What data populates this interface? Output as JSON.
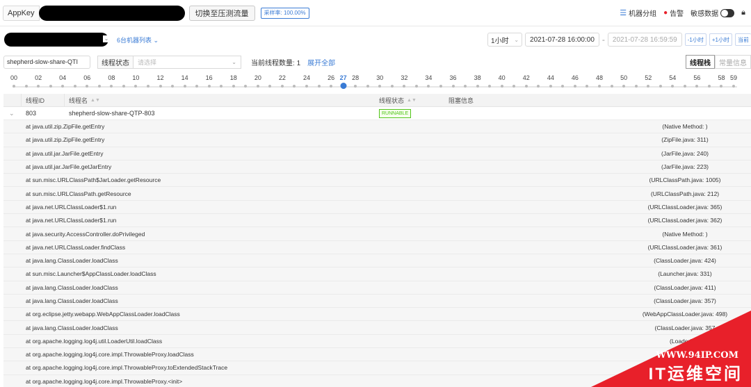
{
  "topbar": {
    "appkey_label": "AppKey",
    "switch_button": "切换至压测流量",
    "sample_rate": "采样率: 100.00%",
    "machine_group": "机器分组",
    "alert": "告警",
    "sensitive": "敏感数据"
  },
  "filter": {
    "machine_list": "6台机器列表",
    "range": "1小时",
    "start_time": "2021-07-28 16:00:00",
    "end_time": "2021-07-28 16:59:59",
    "minus_hour": "-1小时",
    "plus_hour": "+1小时",
    "current": "当前"
  },
  "search": {
    "thread_name": "shepherd-slow-share-QTI",
    "state_label": "线程状态",
    "state_placeholder": "请选择",
    "count_label": "当前线程数量",
    "count_value": "1",
    "expand_all": "展开全部",
    "view_stack": "线程栈",
    "view_constant": "常量信息"
  },
  "timeline": {
    "labels": [
      "00",
      "02",
      "04",
      "06",
      "08",
      "10",
      "12",
      "14",
      "16",
      "18",
      "20",
      "22",
      "24",
      "26",
      "27",
      "28",
      "30",
      "32",
      "34",
      "36",
      "38",
      "40",
      "42",
      "44",
      "46",
      "48",
      "50",
      "52",
      "54",
      "56",
      "58",
      "59"
    ],
    "selected": "27"
  },
  "table": {
    "columns": {
      "id": "线程ID",
      "name": "线程名",
      "state": "线程状态",
      "block": "阻塞信息"
    },
    "row": {
      "id": "803",
      "name": "shepherd-slow-share-QTP-803",
      "state": "RUNNABLE",
      "block": ""
    }
  },
  "stack": [
    {
      "frame": "at java.util.zip.ZipFile.getEntry",
      "loc": "(Native Method: )"
    },
    {
      "frame": "at java.util.zip.ZipFile.getEntry",
      "loc": "(ZipFile.java: 311)"
    },
    {
      "frame": "at java.util.jar.JarFile.getEntry",
      "loc": "(JarFile.java: 240)"
    },
    {
      "frame": "at java.util.jar.JarFile.getJarEntry",
      "loc": "(JarFile.java: 223)"
    },
    {
      "frame": "at sun.misc.URLClassPath$JarLoader.getResource",
      "loc": "(URLClassPath.java: 1005)"
    },
    {
      "frame": "at sun.misc.URLClassPath.getResource",
      "loc": "(URLClassPath.java: 212)"
    },
    {
      "frame": "at java.net.URLClassLoader$1.run",
      "loc": "(URLClassLoader.java: 365)"
    },
    {
      "frame": "at java.net.URLClassLoader$1.run",
      "loc": "(URLClassLoader.java: 362)"
    },
    {
      "frame": "at java.security.AccessController.doPrivileged",
      "loc": "(Native Method: )"
    },
    {
      "frame": "at java.net.URLClassLoader.findClass",
      "loc": "(URLClassLoader.java: 361)"
    },
    {
      "frame": "at java.lang.ClassLoader.loadClass",
      "loc": "(ClassLoader.java: 424)"
    },
    {
      "frame": "at sun.misc.Launcher$AppClassLoader.loadClass",
      "loc": "(Launcher.java: 331)"
    },
    {
      "frame": "at java.lang.ClassLoader.loadClass",
      "loc": "(ClassLoader.java: 411)"
    },
    {
      "frame": "at java.lang.ClassLoader.loadClass",
      "loc": "(ClassLoader.java: 357)"
    },
    {
      "frame": "at org.eclipse.jetty.webapp.WebAppClassLoader.loadClass",
      "loc": "(WebAppClassLoader.java: 498)"
    },
    {
      "frame": "at java.lang.ClassLoader.loadClass",
      "loc": "(ClassLoader.java: 357"
    },
    {
      "frame": "at org.apache.logging.log4j.util.LoaderUtil.loadClass",
      "loc": "(LoaderUtil."
    },
    {
      "frame": "at org.apache.logging.log4j.core.impl.ThrowableProxy.loadClass",
      "loc": "(Thro"
    },
    {
      "frame": "at org.apache.logging.log4j.core.impl.ThrowableProxy.toExtendedStackTrace",
      "loc": ""
    },
    {
      "frame": "at org.apache.logging.log4j.core.impl.ThrowableProxy.<init>",
      "loc": ""
    }
  ],
  "watermark": {
    "url": "WWW.94IP.COM",
    "brand": "IT运维空间"
  },
  "colors": {
    "accent": "#3a7bd5",
    "runnable": "#52c41a",
    "ribbon": "#e8202a"
  }
}
